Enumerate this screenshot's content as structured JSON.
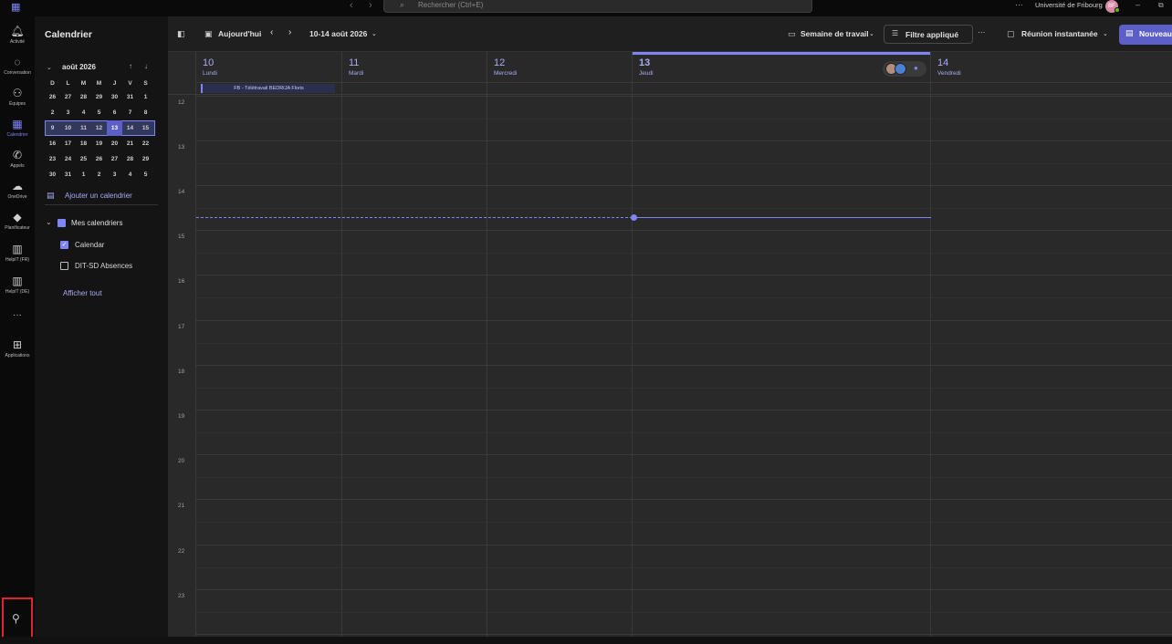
{
  "titlebar": {
    "search_placeholder": "Rechercher (Ctrl+E)",
    "org_name": "Université de Fribourg",
    "user_initials": "BF",
    "more": "···",
    "minimize": "–",
    "restore": "⧉"
  },
  "appbar": {
    "items": [
      {
        "label": "Activité",
        "icon": "bell-icon"
      },
      {
        "label": "Conversation",
        "icon": "chat-icon"
      },
      {
        "label": "Équipes",
        "icon": "teams-icon"
      },
      {
        "label": "Calendrier",
        "icon": "calendar-icon"
      },
      {
        "label": "Appels",
        "icon": "phone-icon"
      },
      {
        "label": "OneDrive",
        "icon": "cloud-icon"
      },
      {
        "label": "Planificateur",
        "icon": "planner-icon"
      },
      {
        "label": "HelpIT (FR)",
        "icon": "building-icon"
      },
      {
        "label": "HelpIT (DE)",
        "icon": "building-icon"
      },
      {
        "label": "Applications",
        "icon": "apps-icon"
      }
    ],
    "more": "···"
  },
  "sidepane": {
    "title": "Calendrier",
    "month": "août 2026",
    "weekdays": [
      "D",
      "L",
      "M",
      "M",
      "J",
      "V",
      "S"
    ],
    "weeks": [
      [
        "26",
        "27",
        "28",
        "29",
        "30",
        "31",
        "1"
      ],
      [
        "2",
        "3",
        "4",
        "5",
        "6",
        "7",
        "8"
      ],
      [
        "9",
        "10",
        "11",
        "12",
        "13",
        "14",
        "15"
      ],
      [
        "16",
        "17",
        "18",
        "19",
        "20",
        "21",
        "22"
      ],
      [
        "23",
        "24",
        "25",
        "26",
        "27",
        "28",
        "29"
      ],
      [
        "30",
        "31",
        "1",
        "2",
        "3",
        "4",
        "5"
      ]
    ],
    "add_calendar": "Ajouter un calendrier",
    "my_calendars": "Mes calendriers",
    "calendars": [
      {
        "label": "Calendar",
        "checked": true
      },
      {
        "label": "DIT-SD Absences",
        "checked": false
      }
    ],
    "show_all": "Afficher tout"
  },
  "toolbar": {
    "today": "Aujourd'hui",
    "range": "10-14 août 2026",
    "view": "Semaine de travail",
    "filter": "Filtre appliqué",
    "more": "···",
    "meet_now": "Réunion instantanée",
    "new": "Nouveau"
  },
  "calendar": {
    "days": [
      {
        "num": "10",
        "name": "Lundi"
      },
      {
        "num": "11",
        "name": "Mardi"
      },
      {
        "num": "12",
        "name": "Mercredi"
      },
      {
        "num": "13",
        "name": "Jeudi"
      },
      {
        "num": "14",
        "name": "Vendredi"
      }
    ],
    "allday_event": "FB - Télétravail BEDRIJA Floris",
    "hours": [
      "12",
      "13",
      "14",
      "15",
      "16",
      "17",
      "18",
      "19",
      "20",
      "21",
      "22",
      "23"
    ]
  },
  "colors": {
    "accent": "#7f85f5",
    "brand_button": "#5b5fc7",
    "highlight_box": "#e0242b"
  }
}
